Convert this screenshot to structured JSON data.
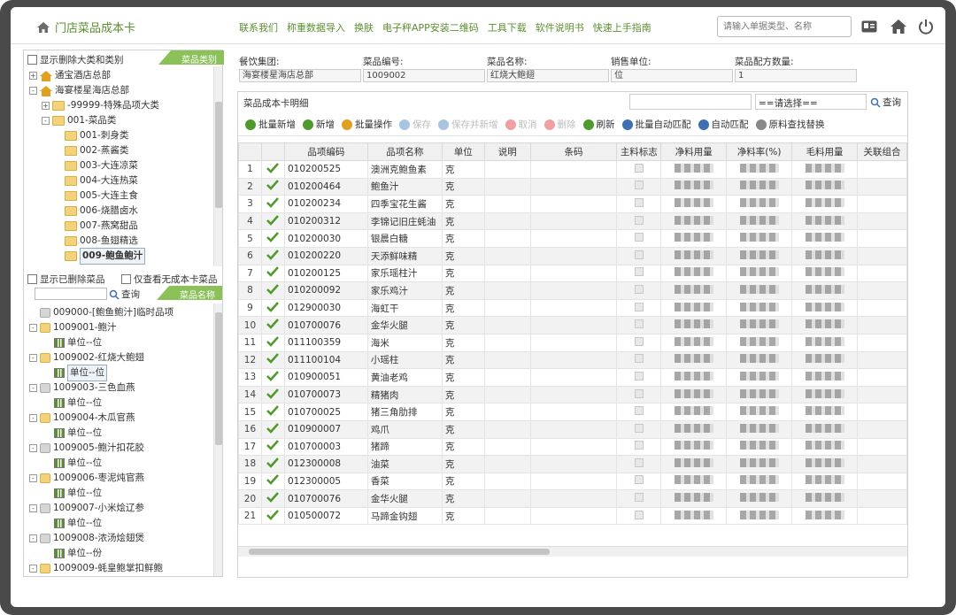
{
  "app": {
    "title": "门店菜品成本卡",
    "nav": [
      "联系我们",
      "称重数据导入",
      "换肤",
      "电子秤APP安装二维码",
      "工具下载",
      "软件说明书",
      "快速上手指南"
    ],
    "search_placeholder": "请输入单据类型、名称"
  },
  "category_panel": {
    "checkbox_label": "显示删除大类和类别",
    "tab_label": "菜品类别",
    "tree": [
      {
        "label": "通宝酒店总部",
        "level": 0,
        "toggle": "+",
        "icon": "house"
      },
      {
        "label": "海宴楼星海店总部",
        "level": 0,
        "toggle": "-",
        "icon": "house"
      },
      {
        "label": "-99999-特殊品项大类",
        "level": 1,
        "toggle": "+",
        "icon": "folder"
      },
      {
        "label": "001-菜品类",
        "level": 1,
        "toggle": "-",
        "icon": "folder"
      },
      {
        "label": "001-刺身类",
        "level": 2,
        "toggle": "",
        "icon": "folder"
      },
      {
        "label": "002-蒸酱类",
        "level": 2,
        "toggle": "",
        "icon": "folder"
      },
      {
        "label": "003-大连凉菜",
        "level": 2,
        "toggle": "",
        "icon": "folder"
      },
      {
        "label": "004-大连热菜",
        "level": 2,
        "toggle": "",
        "icon": "folder"
      },
      {
        "label": "005-大连主食",
        "level": 2,
        "toggle": "",
        "icon": "folder"
      },
      {
        "label": "006-烧腊卤水",
        "level": 2,
        "toggle": "",
        "icon": "folder"
      },
      {
        "label": "007-燕窝甜品",
        "level": 2,
        "toggle": "",
        "icon": "folder"
      },
      {
        "label": "008-鱼翅精选",
        "level": 2,
        "toggle": "",
        "icon": "folder"
      },
      {
        "label": "009-鲍鱼鲍汁",
        "level": 2,
        "toggle": "",
        "icon": "folder",
        "selected": true
      }
    ]
  },
  "dish_panel": {
    "show_deleted_label": "显示已删除菜品",
    "only_no_card_label": "仅查看无成本卡菜品",
    "tab_label": "菜品名称",
    "search_button": "查询",
    "tree": [
      {
        "label": "009000-[鲍鱼鲍汁]临时品项",
        "type": "cube",
        "toggle": ""
      },
      {
        "label": "1009001-鲍汁",
        "type": "cube-y",
        "toggle": "-"
      },
      {
        "label": "单位--位",
        "type": "unit",
        "toggle": ""
      },
      {
        "label": "1009002-红烧大鲍翅",
        "type": "cube-y",
        "toggle": "-"
      },
      {
        "label": "单位--位",
        "type": "unit",
        "toggle": "",
        "selected": true
      },
      {
        "label": "1009003-三色血燕",
        "type": "cube",
        "toggle": "-"
      },
      {
        "label": "单位--位",
        "type": "unit",
        "toggle": ""
      },
      {
        "label": "1009004-木瓜官燕",
        "type": "cube-y",
        "toggle": "-"
      },
      {
        "label": "单位--位",
        "type": "unit",
        "toggle": ""
      },
      {
        "label": "1009005-鲍汁扣花胶",
        "type": "cube",
        "toggle": "-"
      },
      {
        "label": "单位--位",
        "type": "unit",
        "toggle": ""
      },
      {
        "label": "1009006-枣泥炖官燕",
        "type": "cube-y",
        "toggle": "-"
      },
      {
        "label": "单位--位",
        "type": "unit",
        "toggle": ""
      },
      {
        "label": "1009007-小米烩辽参",
        "type": "cube",
        "toggle": "-"
      },
      {
        "label": "单位--位",
        "type": "unit",
        "toggle": ""
      },
      {
        "label": "1009008-浓汤烩翅煲",
        "type": "cube",
        "toggle": "-"
      },
      {
        "label": "单位--份",
        "type": "unit",
        "toggle": ""
      },
      {
        "label": "1009009-蚝皇鲍掌扣鲜鲍",
        "type": "cube-y",
        "toggle": "-"
      }
    ]
  },
  "info": [
    {
      "label": "餐饮集团:",
      "value": "海宴楼星海店总部"
    },
    {
      "label": "菜品编号:",
      "value": "1009002"
    },
    {
      "label": "菜品名称:",
      "value": "红烧大鲍翅"
    },
    {
      "label": "销售单位:",
      "value": "位"
    },
    {
      "label": "菜品配方数量:",
      "value": "1"
    }
  ],
  "detail": {
    "title": "菜品成本卡明细",
    "select_value": "==请选择==",
    "search_button": "查询",
    "toolbar": [
      {
        "label": "批量新增",
        "enabled": true,
        "color": "#4e9a2b"
      },
      {
        "label": "新增",
        "enabled": true,
        "color": "#4e9a2b"
      },
      {
        "label": "批量操作",
        "enabled": true,
        "color": "#e0a020"
      },
      {
        "label": "保存",
        "enabled": false,
        "color": "#a8c4e0"
      },
      {
        "label": "保存并新增",
        "enabled": false,
        "color": "#a8c4e0"
      },
      {
        "label": "取消",
        "enabled": false,
        "color": "#f0a0a0"
      },
      {
        "label": "删除",
        "enabled": false,
        "color": "#f0a0a0"
      },
      {
        "label": "刷新",
        "enabled": true,
        "color": "#4e9a2b"
      },
      {
        "label": "批量自动匹配",
        "enabled": true,
        "color": "#3d6fb3"
      },
      {
        "label": "自动匹配",
        "enabled": true,
        "color": "#3d6fb3"
      },
      {
        "label": "原料查找替换",
        "enabled": true,
        "color": "#888888"
      }
    ],
    "columns": [
      "",
      "",
      "品项编码",
      "品项名称",
      "单位",
      "说明",
      "条码",
      "主料标志",
      "净料用量",
      "净料率(%)",
      "毛料用量",
      "关联组合"
    ],
    "rows": [
      {
        "n": "1",
        "code": "010200525",
        "name": "澳洲克鲍鱼素",
        "unit": "克"
      },
      {
        "n": "2",
        "code": "010200464",
        "name": "鲍鱼汁",
        "unit": "克"
      },
      {
        "n": "3",
        "code": "010200234",
        "name": "四季宝花生酱",
        "unit": "克"
      },
      {
        "n": "4",
        "code": "010200312",
        "name": "李锦记旧庄蚝油",
        "unit": "克"
      },
      {
        "n": "5",
        "code": "010200030",
        "name": "银晨白糖",
        "unit": "克"
      },
      {
        "n": "6",
        "code": "010200220",
        "name": "天添鲜味精",
        "unit": "克"
      },
      {
        "n": "7",
        "code": "010200125",
        "name": "家乐瑶柱汁",
        "unit": "克"
      },
      {
        "n": "8",
        "code": "010200092",
        "name": "家乐鸡汁",
        "unit": "克"
      },
      {
        "n": "9",
        "code": "012900030",
        "name": "海虹干",
        "unit": "克"
      },
      {
        "n": "10",
        "code": "010700076",
        "name": "金华火腿",
        "unit": "克"
      },
      {
        "n": "11",
        "code": "011100359",
        "name": "海米",
        "unit": "克"
      },
      {
        "n": "12",
        "code": "011100104",
        "name": "小瑶柱",
        "unit": "克"
      },
      {
        "n": "13",
        "code": "010900051",
        "name": "黄油老鸡",
        "unit": "克"
      },
      {
        "n": "14",
        "code": "010700073",
        "name": "精猪肉",
        "unit": "克"
      },
      {
        "n": "15",
        "code": "010700025",
        "name": "猪三角肋排",
        "unit": "克"
      },
      {
        "n": "16",
        "code": "010900007",
        "name": "鸡爪",
        "unit": "克"
      },
      {
        "n": "17",
        "code": "010700003",
        "name": "猪蹄",
        "unit": "克"
      },
      {
        "n": "18",
        "code": "012300008",
        "name": "油菜",
        "unit": "克"
      },
      {
        "n": "19",
        "code": "012300005",
        "name": "香菜",
        "unit": "克"
      },
      {
        "n": "20",
        "code": "010700076",
        "name": "金华火腿",
        "unit": "克"
      },
      {
        "n": "21",
        "code": "010500072",
        "name": "马蹄金钩翅",
        "unit": "克"
      }
    ]
  }
}
